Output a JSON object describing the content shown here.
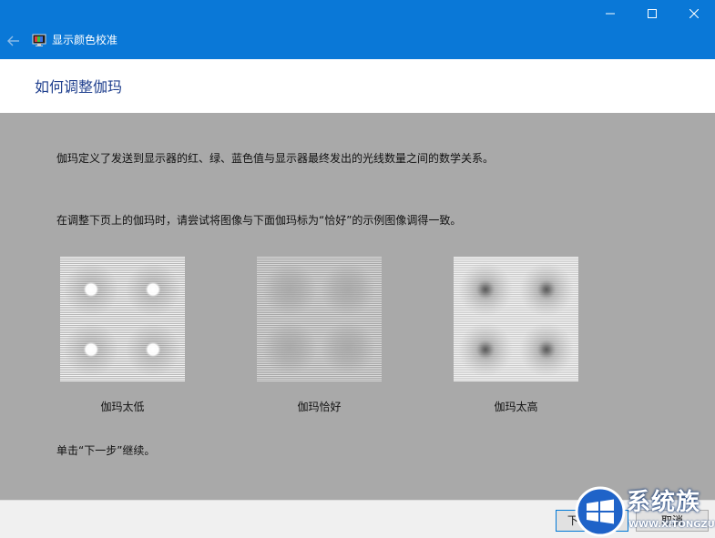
{
  "window": {
    "title": "显示颜色校准",
    "accent_color": "#0a78d7",
    "caption_icons": [
      "minimize-icon",
      "maximize-icon",
      "close-icon"
    ],
    "back_icon": "back-arrow-icon",
    "app_icon": "display-calibration-icon"
  },
  "header": {
    "title": "如何调整伽玛"
  },
  "content": {
    "paragraph1": "伽玛定义了发送到显示器的红、绿、蓝色值与显示器最终发出的光线数量之间的数学关系。",
    "paragraph2": "在调整下页上的伽玛时，请尝试将图像与下面伽玛标为“恰好”的示例图像调得一致。",
    "samples": [
      {
        "label": "伽玛太低",
        "variant": "low"
      },
      {
        "label": "伽玛恰好",
        "variant": "ok"
      },
      {
        "label": "伽玛太高",
        "variant": "high"
      }
    ],
    "paragraph3": "单击“下一步”继续。"
  },
  "footer": {
    "next_label": "下一步(N)",
    "cancel_label": "取消"
  },
  "watermark": {
    "logo_icon": "windows-logo-icon",
    "text": "系统族",
    "subtext": "WWW.XITONGZU.COM"
  }
}
